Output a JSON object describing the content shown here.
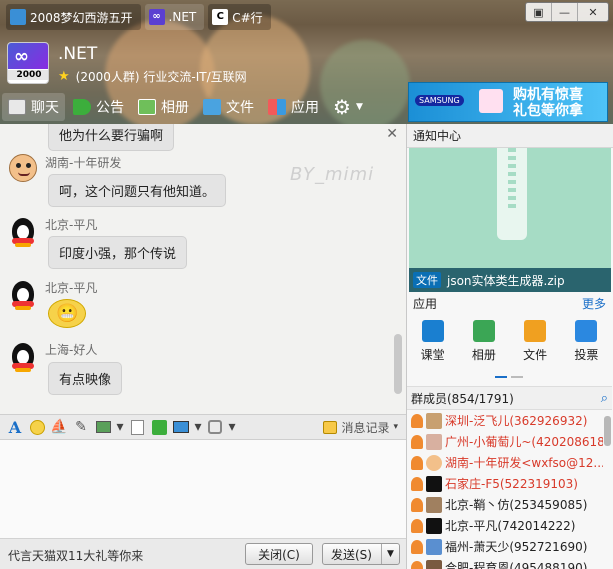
{
  "tabs": [
    {
      "label": "2008梦幻西游五开",
      "color": "#3a8fd6"
    },
    {
      "label": ".NET",
      "color": "#5b3fd1"
    },
    {
      "label": "C#行",
      "color": "#222222"
    }
  ],
  "window_controls": [
    "▣",
    "—",
    "✕"
  ],
  "group": {
    "name": ".NET",
    "logo_year": "2000",
    "subtitle": "(2000人群) 行业交流-IT/互联网"
  },
  "nav": [
    {
      "label": "聊天",
      "icon": "chat-icon"
    },
    {
      "label": "公告",
      "icon": "megaphone-icon"
    },
    {
      "label": "相册",
      "icon": "album-icon"
    },
    {
      "label": "文件",
      "icon": "folder-icon"
    },
    {
      "label": "应用",
      "icon": "apps-icon"
    }
  ],
  "ad": {
    "brand": "SAMSUNG",
    "line1": "购机有惊喜",
    "line2": "礼包等你拿"
  },
  "chat": {
    "watermark": "BY_mimi",
    "messages": [
      {
        "sender": "",
        "text": "他为什么要行骗啊",
        "avatar": "none"
      },
      {
        "sender": "湖南-十年研发",
        "text": "呵，这个问题只有他知道。",
        "avatar": "face-avatar"
      },
      {
        "sender": "北京-平凡",
        "text": "印度小强，那个传说",
        "avatar": "penguin-avatar"
      },
      {
        "sender": "北京-平凡",
        "text": "😬",
        "avatar": "penguin-avatar"
      },
      {
        "sender": "上海-好人",
        "text": "有点映像",
        "avatar": "penguin-avatar"
      }
    ]
  },
  "toolbar": {
    "history_label": "消息记录"
  },
  "footer": {
    "promo": "代言天猫双11大礼等你来",
    "close_label": "关闭(C)",
    "send_label": "发送(S)"
  },
  "right": {
    "notice_title": "通知中心",
    "file_tag": "文件",
    "file_name": "json实体类生成器.zip",
    "apps_title": "应用",
    "more_label": "更多",
    "apps": [
      {
        "label": "课堂",
        "color": "#1a7fd0"
      },
      {
        "label": "相册",
        "color": "#3ba655"
      },
      {
        "label": "文件",
        "color": "#f0a020"
      },
      {
        "label": "投票",
        "color": "#2b88e0"
      }
    ],
    "members_title": "群成员(854/1791)",
    "members": [
      {
        "name": "深圳-泛飞儿(362926932)",
        "color": "#d83a2a",
        "role": "#f08a30"
      },
      {
        "name": "广州-小葡萄儿~(420208618)",
        "color": "#d83a2a",
        "role": "#f08a30"
      },
      {
        "name": "湖南-十年研发<wxfso@12...",
        "color": "#d83a2a",
        "role": "#f08a30"
      },
      {
        "name": "石家庄-F5(522319103)",
        "color": "#d83a2a",
        "role": "#f08a30"
      },
      {
        "name": "北京-鞘丶仿(253459085)",
        "color": "#222222",
        "role": "#f08a30"
      },
      {
        "name": "北京-平凡(742014222)",
        "color": "#222222",
        "role": "#f08a30"
      },
      {
        "name": "福州-萧天少(952721690)",
        "color": "#222222",
        "role": "#f08a30"
      },
      {
        "name": "合肥-程育恩(495488190)",
        "color": "#222222",
        "role": "#f08a30"
      }
    ]
  },
  "colors": {
    "accent": "#1a6fc8",
    "header": "#7a6a52"
  }
}
